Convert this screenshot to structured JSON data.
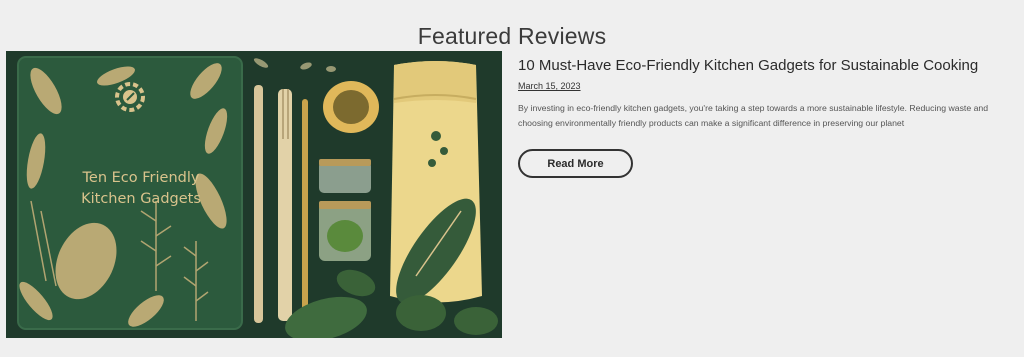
{
  "section": {
    "title": "Featured Reviews"
  },
  "post": {
    "image": {
      "alt": "Eco friendly kitchen gadgets flat lay",
      "book_text": "Ten Eco Friendly Kitchen Gadgets"
    },
    "title": "10 Must-Have Eco-Friendly Kitchen Gadgets for Sustainable Cooking",
    "date": "March 15, 2023",
    "excerpt": "By investing in eco-friendly kitchen gadgets, you're taking a step towards a more sustainable lifestyle. Reducing waste and choosing environmentally friendly products can make a significant difference in preserving our planet",
    "read_more_label": "Read More"
  },
  "colors": {
    "background": "#efefef",
    "image_green": "#1f3a2b",
    "book_green": "#2c5a3d",
    "gold": "#d9c38c",
    "text": "#2b2b2b"
  }
}
